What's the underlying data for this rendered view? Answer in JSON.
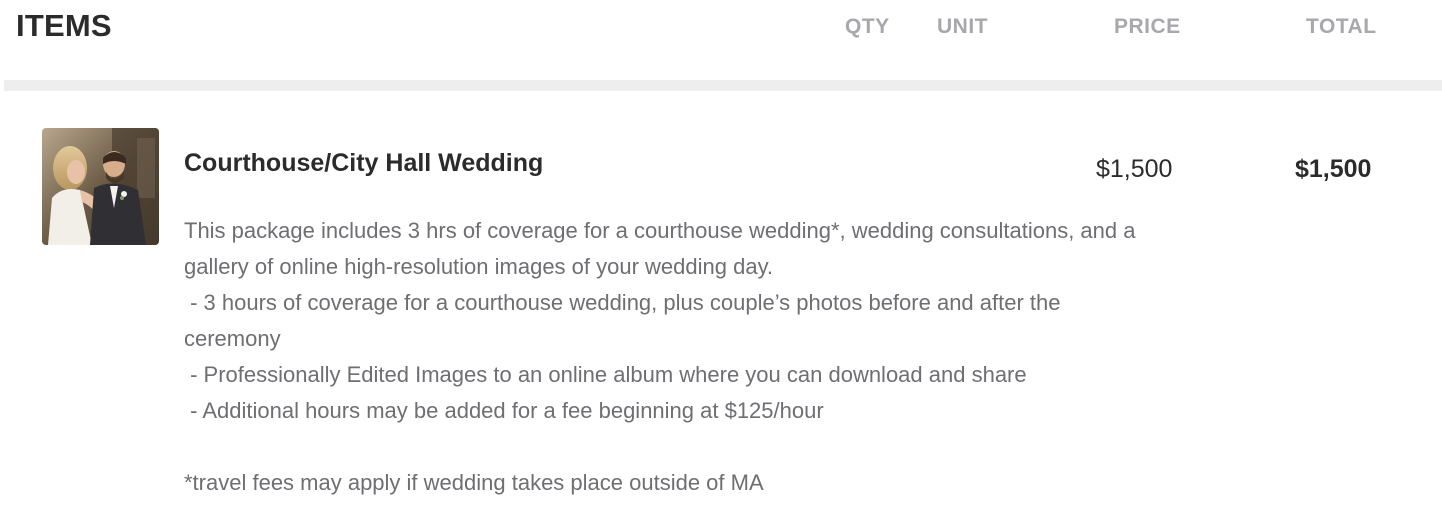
{
  "header": {
    "title": "ITEMS",
    "columns": {
      "qty": "QTY",
      "unit": "UNIT",
      "price": "PRICE",
      "total": "TOTAL"
    }
  },
  "item": {
    "thumbnail_icon": "wedding-photo-thumbnail",
    "title": "Courthouse/City Hall Wedding",
    "price": "$1,500",
    "total": "$1,500",
    "description": {
      "line1": "This package includes 3 hrs of coverage for a courthouse wedding*, wedding consultations, and a",
      "line2": "gallery of online high-resolution images of your wedding day.",
      "line3": " - 3 hours of coverage for a courthouse wedding, plus couple’s photos before and after the",
      "line4": "ceremony",
      "line5": " - Professionally Edited Images to an online album where you can download and share",
      "line6": " - Additional hours may be added for a fee beginning at $125/hour",
      "line7": "*travel fees may apply if wedding takes place outside of MA"
    }
  },
  "colors": {
    "title_text": "#2b2b2b",
    "column_head": "#a8a8ac",
    "body_text": "#6e6e73",
    "divider": "#eeeeee"
  }
}
